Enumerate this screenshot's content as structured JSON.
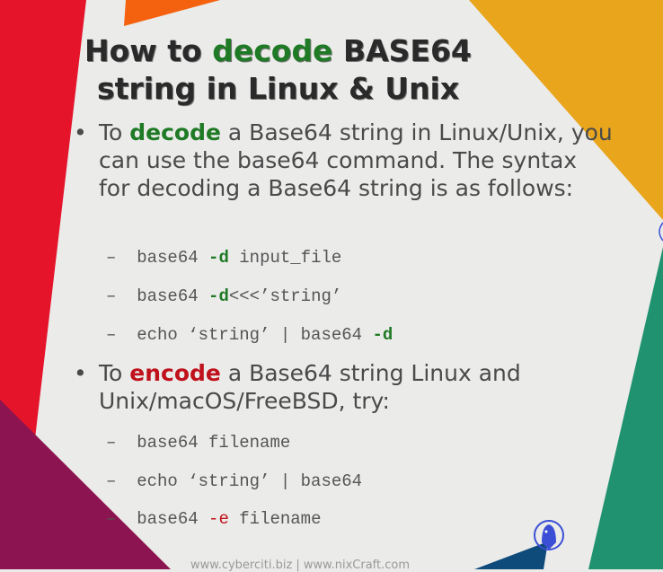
{
  "title": {
    "part1": "How to ",
    "highlight": "decode",
    "part2": " BASE64",
    "line2": "string in Linux & Unix"
  },
  "bullets": [
    {
      "pre": "To ",
      "highlight": "decode",
      "post": " a Base64 string in Linux/Unix, you can use the base64 command. The syntax for decoding a Base64 string is as follows:",
      "commands": [
        {
          "dash": "–",
          "a": "base64 ",
          "flag": "-d",
          "b": " input_file"
        },
        {
          "dash": "–",
          "a": "base64 ",
          "flag": "-d",
          "b": "<<<’string’"
        },
        {
          "dash": "–",
          "a": "echo ‘string’ | base64 ",
          "flag": "-d",
          "b": ""
        }
      ]
    },
    {
      "pre": "To ",
      "highlight": "encode",
      "post": " a Base64 string Linux and Unix/macOS/FreeBSD, try:",
      "commands": [
        {
          "dash": "–",
          "a": "base64 filename",
          "flag": "",
          "b": ""
        },
        {
          "dash": "–",
          "a": "echo ‘string’ | base64",
          "flag": "",
          "b": ""
        },
        {
          "dash": "–",
          "a": "base64 ",
          "flag": "-e",
          "b": " filename"
        }
      ]
    }
  ],
  "footer": "www.cyberciti.biz | www.nixCraft.com",
  "colors": {
    "green": "#1f7a25",
    "red": "#c0121c",
    "shape_red": "#e5142b",
    "shape_orange": "#f5620f",
    "shape_yellow": "#e9a51b",
    "shape_purple": "#8c1450",
    "shape_teal": "#20926f",
    "shape_blue": "#0e4a7a"
  }
}
